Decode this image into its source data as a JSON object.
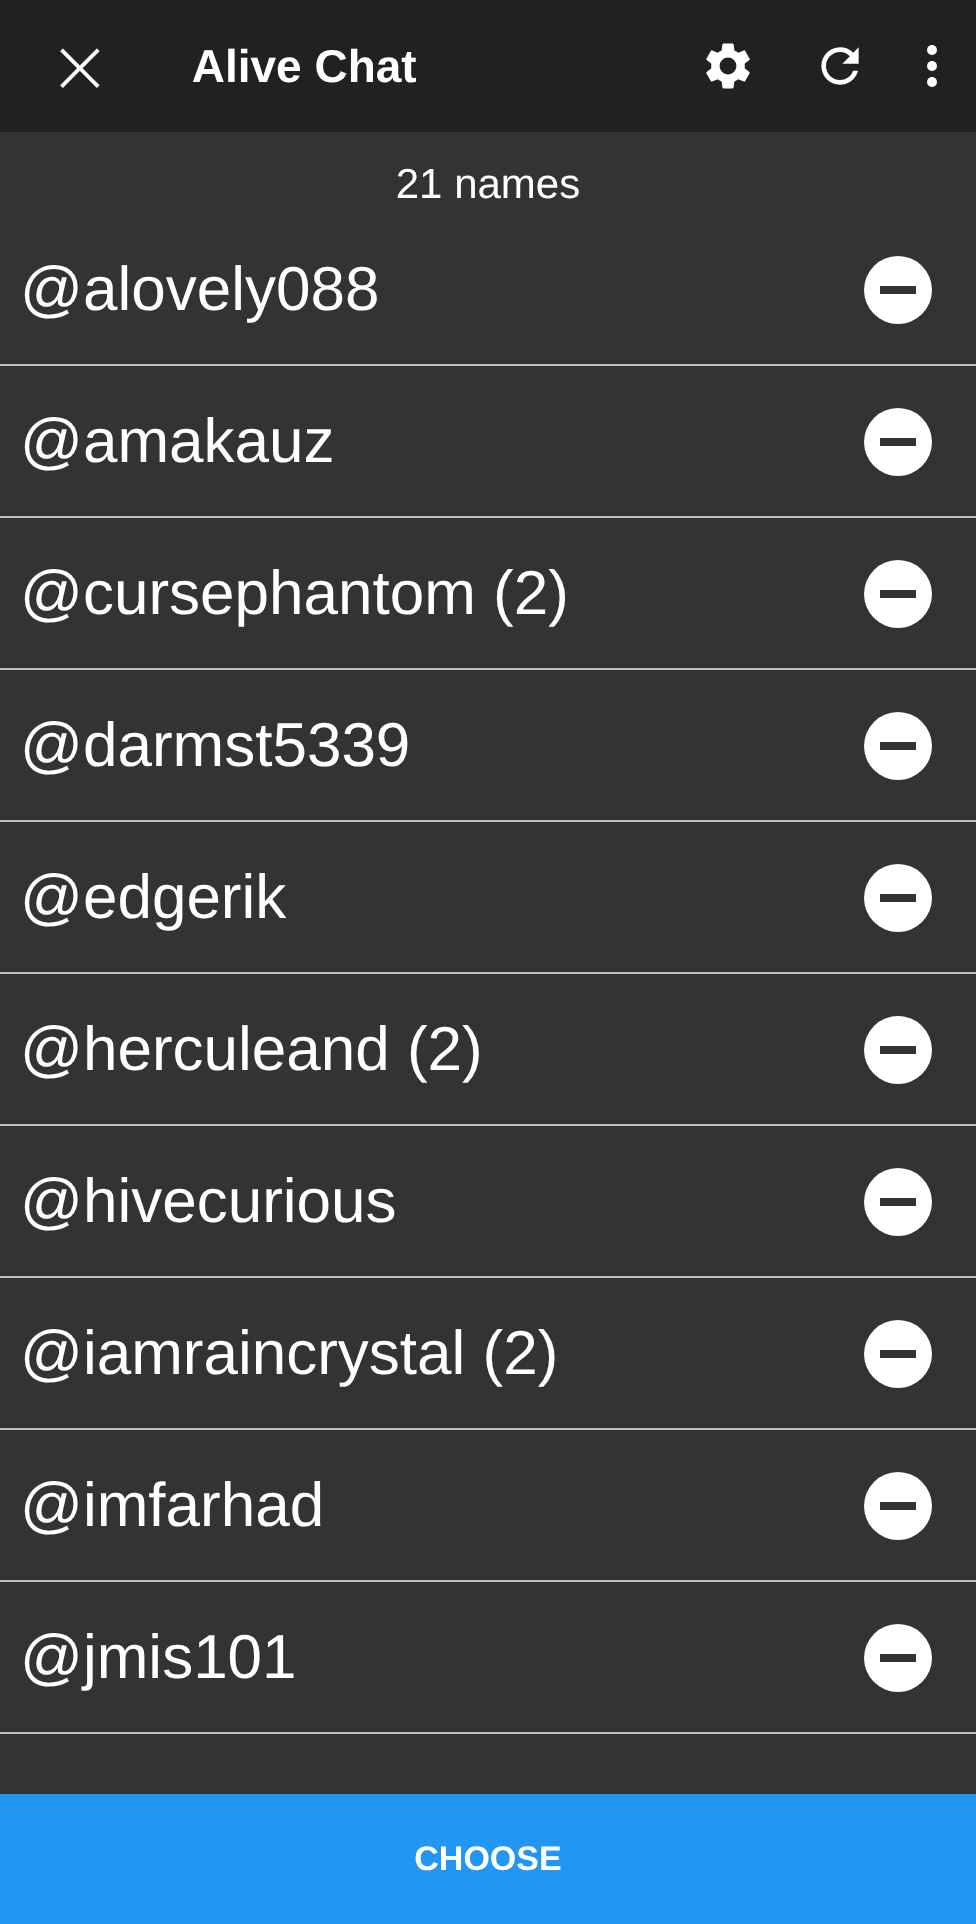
{
  "app_bar": {
    "close": "×",
    "title": "Alive Chat"
  },
  "count": "21 names",
  "names": [
    {
      "name": "@alovely088"
    },
    {
      "name": "@amakauz"
    },
    {
      "name": "@cursephantom (2)"
    },
    {
      "name": "@darmst5339"
    },
    {
      "name": "@edgerik"
    },
    {
      "name": "@herculeand (2)"
    },
    {
      "name": "@hivecurious"
    },
    {
      "name": "@iamraincrystal (2)"
    },
    {
      "name": "@imfarhad"
    },
    {
      "name": "@jmis101"
    }
  ],
  "button": "CHOOSE"
}
